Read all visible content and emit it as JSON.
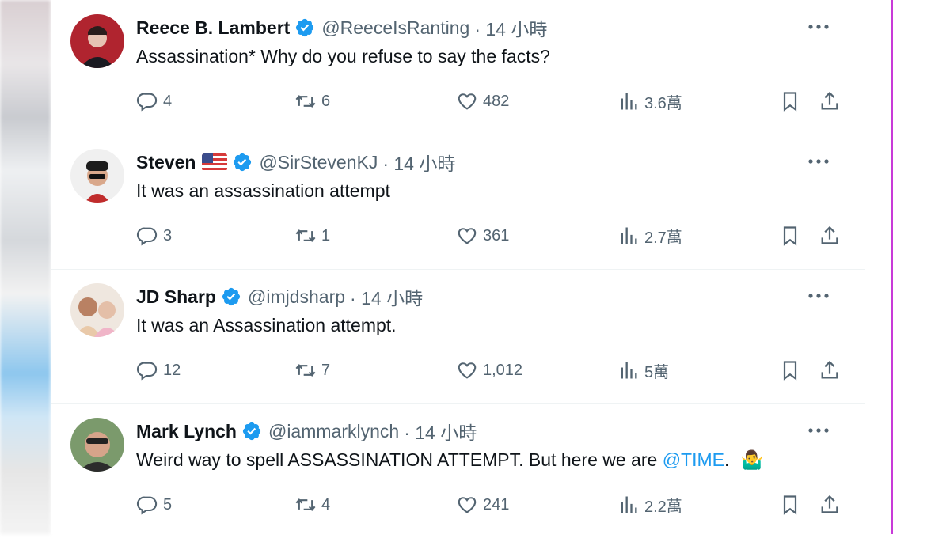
{
  "tweets": [
    {
      "name": "Reece B. Lambert",
      "has_flag": false,
      "handle": "@ReeceIsRanting",
      "time": "· 14 小時",
      "text": "Assassination* Why do you refuse to say the facts?",
      "mention": "",
      "emoji": "",
      "replies": "4",
      "retweets": "6",
      "likes": "482",
      "views": "3.6萬",
      "avatar_color": "#b0242f"
    },
    {
      "name": "Steven",
      "has_flag": true,
      "handle": "@SirStevenKJ",
      "time": "· 14 小時",
      "text": "It was an assassination attempt",
      "mention": "",
      "emoji": "",
      "replies": "3",
      "retweets": "1",
      "likes": "361",
      "views": "2.7萬",
      "avatar_color": "#e8e8e8"
    },
    {
      "name": "JD Sharp",
      "has_flag": false,
      "handle": "@imjdsharp",
      "time": "· 14 小時",
      "text": "It was an Assassination attempt.",
      "mention": "",
      "emoji": "",
      "replies": "12",
      "retweets": "7",
      "likes": "1,012",
      "views": "5萬",
      "avatar_color": "#c8a58c"
    },
    {
      "name": "Mark Lynch",
      "has_flag": false,
      "handle": "@iammarklynch",
      "time": "· 14 小時",
      "text": "Weird way to spell ASSASSINATION ATTEMPT.  But here we are ",
      "mention": "@TIME",
      "emoji": "🤷‍♂️",
      "text_end": ".",
      "replies": "5",
      "retweets": "4",
      "likes": "241",
      "views": "2.2萬",
      "avatar_color": "#6a8a5e"
    }
  ],
  "colors": {
    "verified": "#1d9bf0",
    "secondary_text": "#536471",
    "mention": "#1d9bf0",
    "right_border": "#c83ad8"
  },
  "icons": [
    "reply-icon",
    "retweet-icon",
    "like-icon",
    "views-icon",
    "bookmark-icon",
    "share-icon",
    "more-icon",
    "verified-badge-icon"
  ]
}
